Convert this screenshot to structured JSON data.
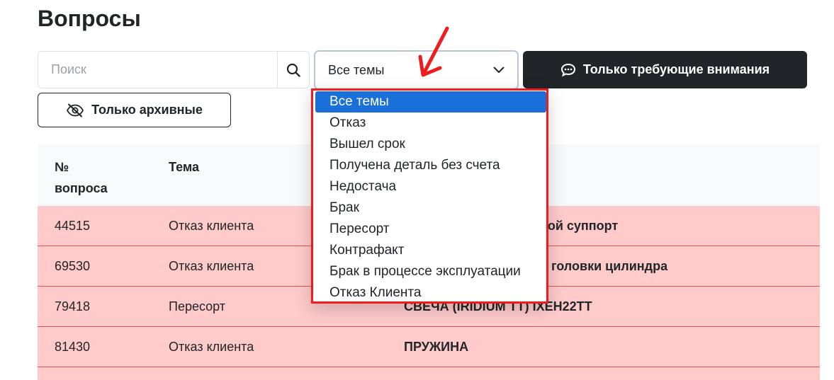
{
  "page": {
    "title": "Вопросы"
  },
  "search": {
    "placeholder": "Поиск",
    "icon": "search-icon"
  },
  "topic_select": {
    "value": "Все темы",
    "icon": "chevron-down-icon"
  },
  "attention_button": {
    "label": "Только требующие внимания",
    "icon": "chat-dots-icon"
  },
  "archive_button": {
    "label": "Только архивные",
    "icon": "eye-slash-icon"
  },
  "dropdown": {
    "selected_index": 0,
    "options": [
      "Все темы",
      "Отказ",
      "Вышел срок",
      "Получена деталь без счета",
      "Недостача",
      "Брак",
      "Пересорт",
      "Контрафакт",
      "Брак в процессе эксплуатации",
      "Отказ Клиента"
    ]
  },
  "table": {
    "headers": {
      "number_line1": "№",
      "number_line2": "вопроса",
      "topic": "Тема"
    },
    "rows": [
      {
        "number": "44515",
        "topic": "Отказ клиента",
        "item": "зной суппорт"
      },
      {
        "number": "69530",
        "topic": "Отказ клиента",
        "item": "головки цилиндра"
      },
      {
        "number": "79418",
        "topic": "Пересорт",
        "item": "СВЕЧА (IRIDIUM TT) IXEH22TT"
      },
      {
        "number": "81430",
        "topic": "Отказ клиента",
        "item": "ПРУЖИНА"
      }
    ]
  },
  "colors": {
    "row_highlight": "#fecaca",
    "row_border": "#e4514a",
    "annotation_red": "#ee1c1c",
    "selected_blue": "#1a6fd8",
    "dark_button": "#212529"
  }
}
